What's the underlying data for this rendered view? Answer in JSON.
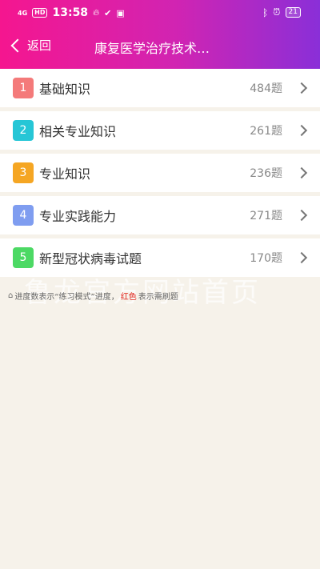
{
  "status_bar": {
    "network": "4G",
    "hd": "HD",
    "time": "13:58",
    "icons": [
      "fire-icon",
      "check-circle-icon",
      "media-icon"
    ],
    "right_icons": [
      "bluetooth-icon",
      "alarm-icon"
    ],
    "battery": "21"
  },
  "nav": {
    "back_label": "返回",
    "title": "康复医学治疗技术…"
  },
  "categories": [
    {
      "index": "1",
      "label": "基础知识",
      "count": "484题",
      "color": "#f47a7a"
    },
    {
      "index": "2",
      "label": "相关专业知识",
      "count": "261题",
      "color": "#26c6d6"
    },
    {
      "index": "3",
      "label": "专业知识",
      "count": "236题",
      "color": "#f5a623"
    },
    {
      "index": "4",
      "label": "专业实践能力",
      "count": "271题",
      "color": "#7f9df0"
    },
    {
      "index": "5",
      "label": "新型冠状病毒试题",
      "count": "170题",
      "color": "#4cd964"
    }
  ],
  "footer_note": {
    "part1": "进度数表示“练习模式”进度，",
    "red": "红色",
    "part2": "表示需刷题"
  },
  "watermark": "鲁龙官方网站首页"
}
